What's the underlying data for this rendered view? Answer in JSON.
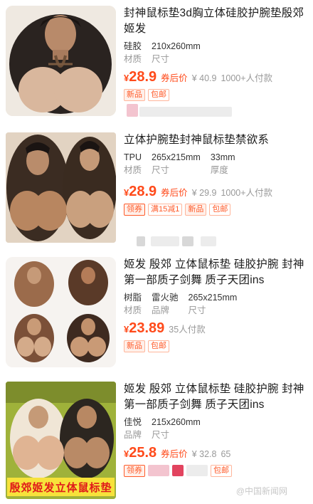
{
  "products": [
    {
      "title": "封神鼠标垫3d胸立体硅胶护腕垫殷郊姬发",
      "attributes": [
        {
          "value": "硅胶",
          "key": "材质"
        },
        {
          "value": "210x260mm",
          "key": "尺寸"
        }
      ],
      "price_currency": "¥",
      "price": "28.9",
      "price_after_label": "券后价",
      "original_price": "¥ 40.9",
      "sold": "1000+人付款",
      "tags": [
        "新品",
        "包邮"
      ]
    },
    {
      "title": "立体护腕垫封神鼠标垫禁欲系",
      "attributes": [
        {
          "value": "TPU",
          "key": "材质"
        },
        {
          "value": "265x215mm",
          "key": "尺寸"
        },
        {
          "value": "33mm",
          "key": "厚度"
        }
      ],
      "price_currency": "¥",
      "price": "28.9",
      "price_after_label": "券后价",
      "original_price": "¥ 29.9",
      "sold": "1000+人付款",
      "tags": [
        "领券",
        "满15减1",
        "新品",
        "包邮"
      ]
    },
    {
      "title": "姬发 殷郊 立体鼠标垫 硅胶护腕 封神第一部质子剑舞 质子天团ins",
      "attributes": [
        {
          "value": "树脂",
          "key": "材质"
        },
        {
          "value": "雷火驰",
          "key": "品牌"
        },
        {
          "value": "265x215mm",
          "key": "尺寸"
        }
      ],
      "price_currency": "¥",
      "price": "23.89",
      "price_after_label": "",
      "original_price": "",
      "sold": "35人付款",
      "tags": [
        "新品",
        "包邮"
      ]
    },
    {
      "title": "姬发 殷郊 立体鼠标垫 硅胶护腕 封神第一部质子剑舞 质子天团ins",
      "attributes": [
        {
          "value": "佳悦",
          "key": "品牌"
        },
        {
          "value": "215x260mm",
          "key": "尺寸"
        }
      ],
      "price_currency": "¥",
      "price": "25.8",
      "price_after_label": "券后价",
      "original_price": "¥ 32.8",
      "sold": "65",
      "tags": [
        "领券",
        "包邮"
      ],
      "image_banner": "殷郊姬发立体鼠标垫"
    }
  ],
  "watermark": "@中国新闻网",
  "colors": {
    "price": "#ff4a1a",
    "tag_border": "#ffb59a",
    "banner_bg": "#f7e23b",
    "banner_text": "#e01a1a"
  }
}
